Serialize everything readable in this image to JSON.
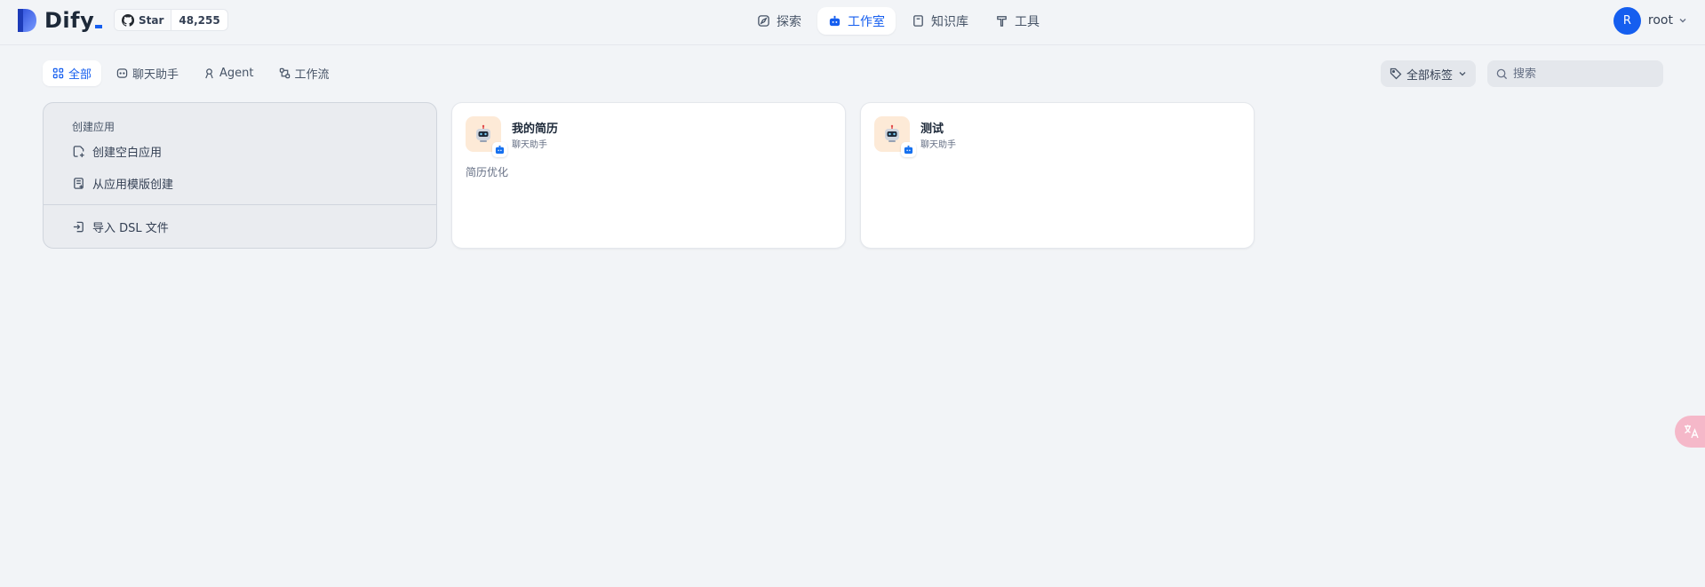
{
  "header": {
    "logo_text": "Dify",
    "github": {
      "star_label": "Star",
      "count": "48,255"
    },
    "nav": [
      {
        "label": "探索",
        "icon": "compass-icon",
        "active": false
      },
      {
        "label": "工作室",
        "icon": "robot-icon",
        "active": true
      },
      {
        "label": "知识库",
        "icon": "book-icon",
        "active": false
      },
      {
        "label": "工具",
        "icon": "hammer-icon",
        "active": false
      }
    ],
    "user": {
      "initial": "R",
      "name": "root"
    }
  },
  "toolbar": {
    "tabs": [
      {
        "label": "全部",
        "icon": "grid-icon",
        "active": true
      },
      {
        "label": "聊天助手",
        "icon": "chat-icon",
        "active": false
      },
      {
        "label": "Agent",
        "icon": "agent-icon",
        "active": false
      },
      {
        "label": "工作流",
        "icon": "workflow-icon",
        "active": false
      }
    ],
    "tag_filter_label": "全部标签",
    "search_placeholder": "搜索"
  },
  "create_card": {
    "title": "创建应用",
    "items": [
      {
        "label": "创建空白应用",
        "icon": "file-plus-icon"
      },
      {
        "label": "从应用模版创建",
        "icon": "template-icon"
      },
      {
        "label": "导入 DSL 文件",
        "icon": "import-icon"
      }
    ]
  },
  "apps": [
    {
      "name": "我的简历",
      "type": "聊天助手",
      "description": "简历优化"
    },
    {
      "name": "测试",
      "type": "聊天助手",
      "description": ""
    }
  ],
  "colors": {
    "accent": "#155eef",
    "background": "#f2f4f7",
    "app_icon_bg": "#fdead7"
  }
}
